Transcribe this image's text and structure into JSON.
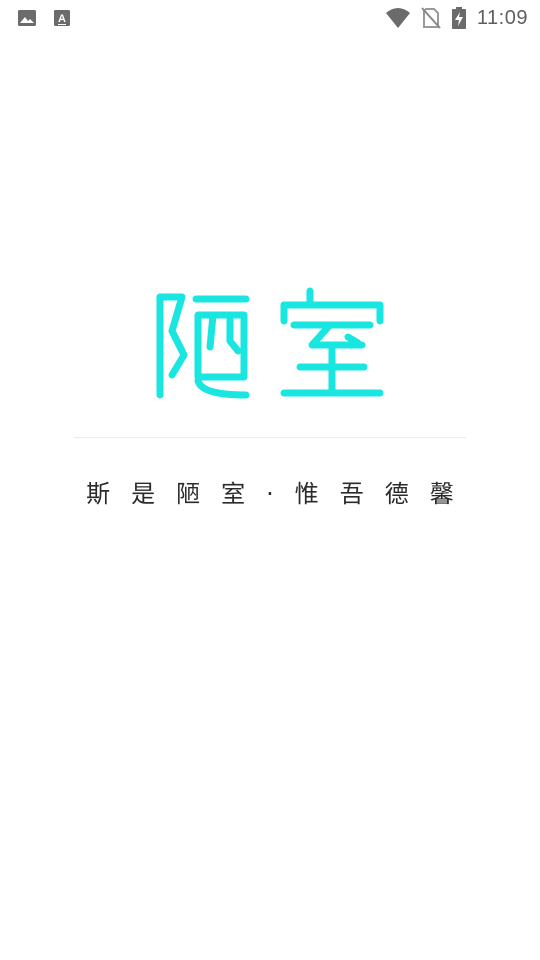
{
  "status_bar": {
    "time": "11:09",
    "left_icons": [
      "image-icon",
      "text-a-icon"
    ],
    "right_icons": [
      "wifi-icon",
      "no-sim-icon",
      "battery-charging-icon"
    ]
  },
  "splash": {
    "logo_text": "陋室",
    "tagline": "斯是陋室·惟吾德馨"
  },
  "colors": {
    "brand": "#19e6e0",
    "text": "#2b2b2b",
    "status_icons": "#6b6b6b",
    "background": "#ffffff"
  }
}
